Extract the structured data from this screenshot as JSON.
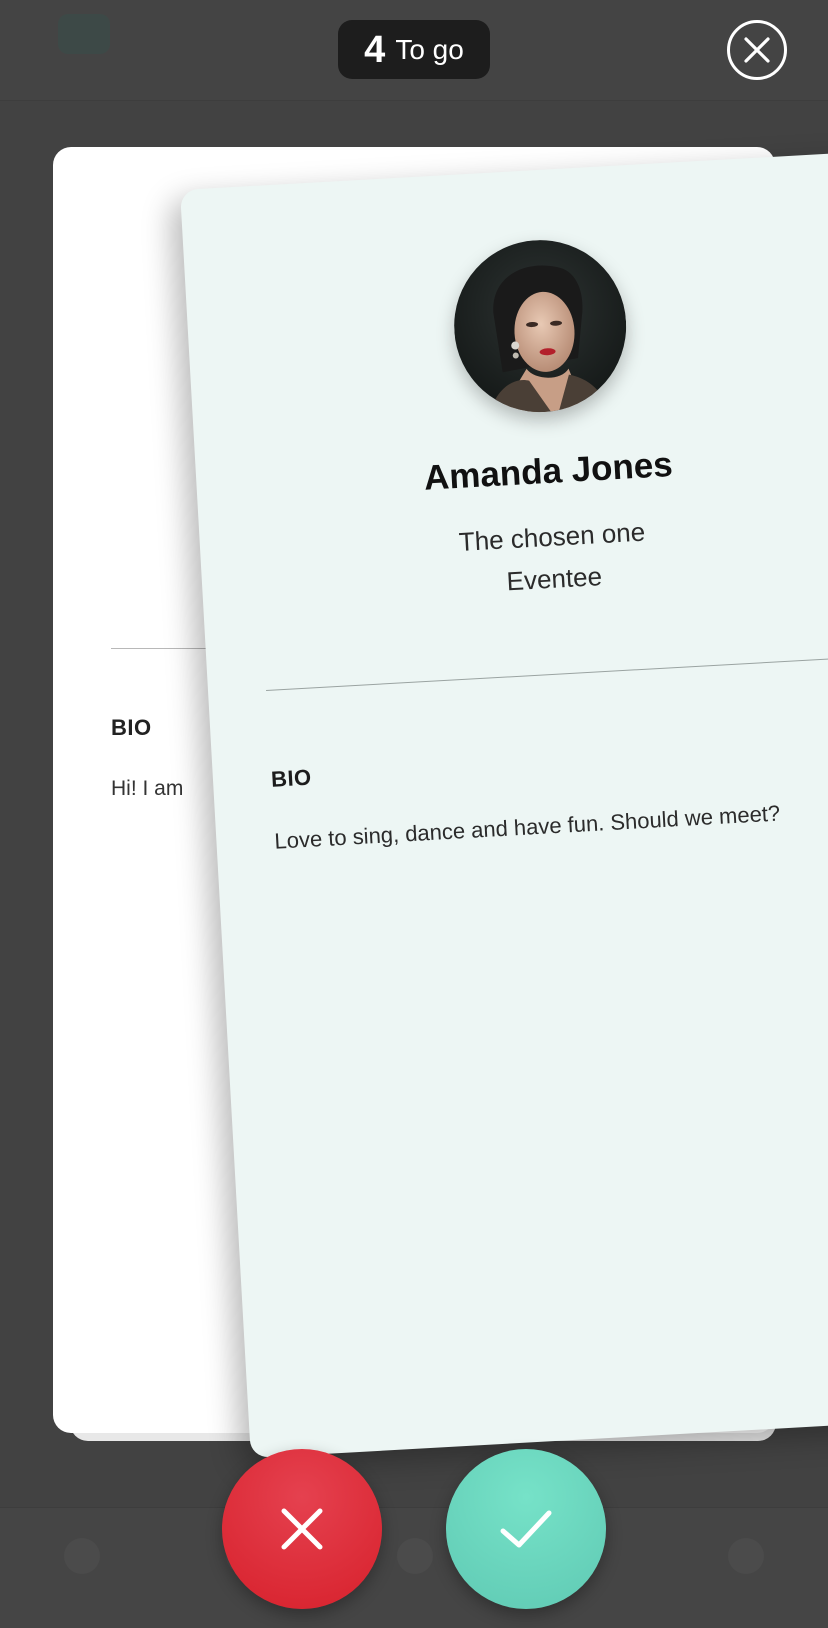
{
  "counter": {
    "number": "4",
    "label": "To go"
  },
  "close_icon": "close-icon",
  "back_card": {
    "bio_label": "BIO",
    "bio_text": "Hi! I am"
  },
  "front_card": {
    "name": "Amanda Jones",
    "role": "The chosen one",
    "company": "Eventee",
    "bio_label": "BIO",
    "bio_text": "Love to sing, dance and have fun. Should we meet?"
  },
  "actions": {
    "reject_icon": "close-icon",
    "accept_icon": "check-icon"
  },
  "colors": {
    "overlay": "#424242",
    "reject": "#dc2a36",
    "accept": "#6ad6bd",
    "card_front": "#edf6f4",
    "card_back": "#ffffff",
    "pill": "#1d1d1d"
  }
}
